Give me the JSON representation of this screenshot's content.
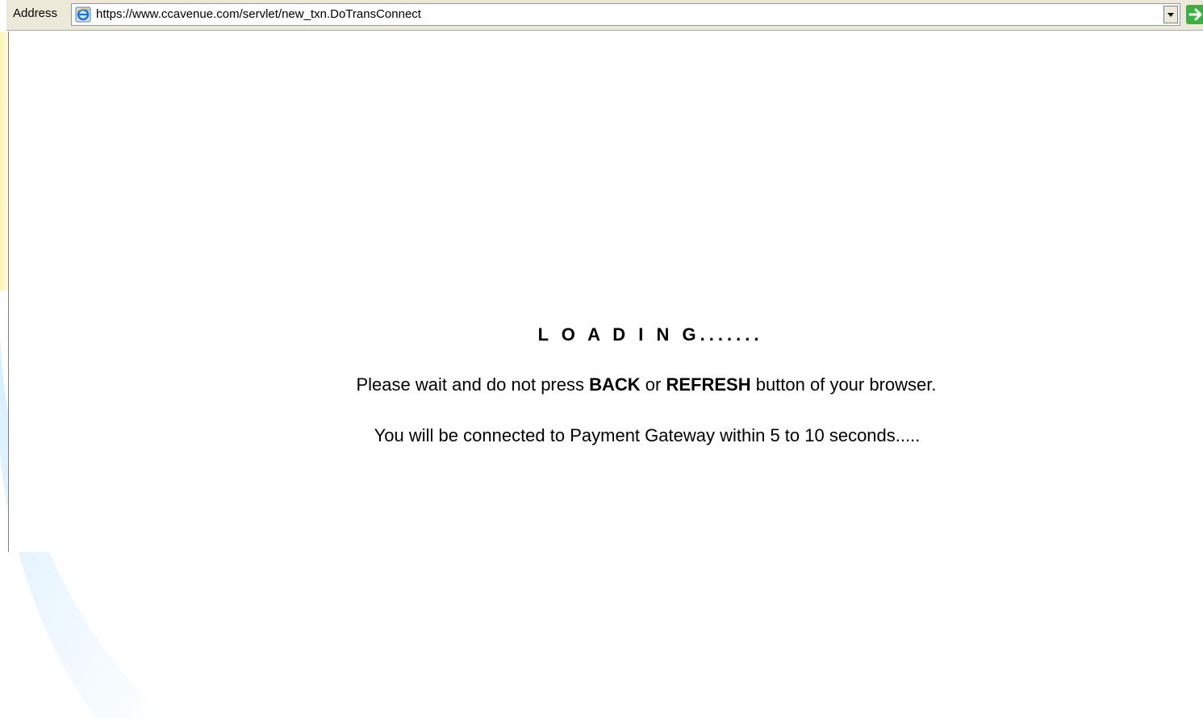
{
  "browser": {
    "address_label": "Address",
    "url": "https://www.ccavenue.com/servlet/new_txn.DoTransConnect"
  },
  "page": {
    "loading_title": "L O A D I N G.......",
    "warning_prefix": "Please wait and do not press ",
    "warning_back": "BACK",
    "warning_or": " or ",
    "warning_refresh": "REFRESH",
    "warning_suffix": " button of your browser.",
    "connect_text": "You will be connected to Payment Gateway within 5 to 10 seconds....."
  },
  "colors": {
    "backdrop_accent_yellow": "#fff7c8",
    "backdrop_accent_blue": "#e6f4ff",
    "go_arrow_green": "#3cb043"
  }
}
